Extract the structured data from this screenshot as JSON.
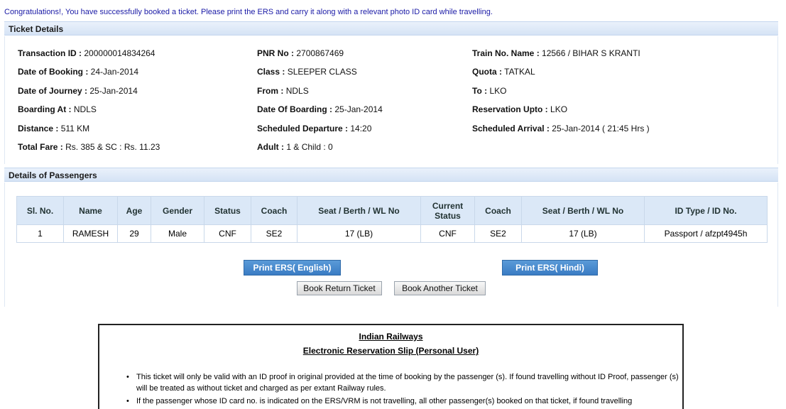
{
  "message": "Congratulations!, You have successfully booked a ticket. Please print the ERS and carry it along with a relevant photo ID card while travelling.",
  "ticket": {
    "heading": "Ticket Details",
    "transaction_id_label": "Transaction ID :",
    "transaction_id": "200000014834264",
    "pnr_label": "PNR No :",
    "pnr": "2700867469",
    "train_label": "Train No. Name :",
    "train": "12566 / BIHAR S KRANTI",
    "booking_date_label": "Date of Booking :",
    "booking_date": "24-Jan-2014",
    "class_label": "Class :",
    "class": "SLEEPER CLASS",
    "quota_label": "Quota :",
    "quota": "TATKAL",
    "journey_date_label": "Date of Journey :",
    "journey_date": "25-Jan-2014",
    "from_label": "From :",
    "from": "NDLS",
    "to_label": "To :",
    "to": "LKO",
    "boarding_label": "Boarding At :",
    "boarding": "NDLS",
    "boarding_date_label": "Date Of Boarding :",
    "boarding_date": "25-Jan-2014",
    "upto_label": "Reservation Upto :",
    "upto": "LKO",
    "distance_label": "Distance :",
    "distance": "511 KM",
    "departure_label": "Scheduled Departure :",
    "departure": "14:20",
    "arrival_label": "Scheduled Arrival :",
    "arrival": "25-Jan-2014 ( 21:45 Hrs )",
    "fare_label": "Total Fare :",
    "fare": "Rs. 385 & SC : Rs. 11.23",
    "pax_count_label": "Adult :",
    "pax_count": "1 & Child : 0"
  },
  "passengers": {
    "heading": "Details of Passengers",
    "columns": [
      "Sl. No.",
      "Name",
      "Age",
      "Gender",
      "Status",
      "Coach",
      "Seat / Berth / WL No",
      "Current Status",
      "Coach",
      "Seat / Berth / WL No",
      "ID Type / ID No."
    ],
    "rows": [
      [
        "1",
        "RAMESH",
        "29",
        "Male",
        "CNF",
        "SE2",
        "17 (LB)",
        "CNF",
        "SE2",
        "17 (LB)",
        "Passport / afzpt4945h"
      ]
    ]
  },
  "buttons": {
    "print_english": "Print ERS( English)",
    "print_hindi": "Print ERS( Hindi)",
    "book_return": "Book Return Ticket",
    "book_another": "Book Another Ticket"
  },
  "ers": {
    "title": "Indian Railways",
    "subtitle": "Electronic Reservation Slip (Personal User)",
    "notes": [
      "This ticket will only be valid with an ID proof in original provided at the time of booking by the passenger (s). If found travelling without ID Proof, passenger (s) will be treated as without ticket and charged as per extant Railway rules.",
      "If the passenger whose ID card no. is indicated on the ERS/VRM is not travelling, all other passenger(s) booked on that ticket, if found travelling"
    ]
  }
}
